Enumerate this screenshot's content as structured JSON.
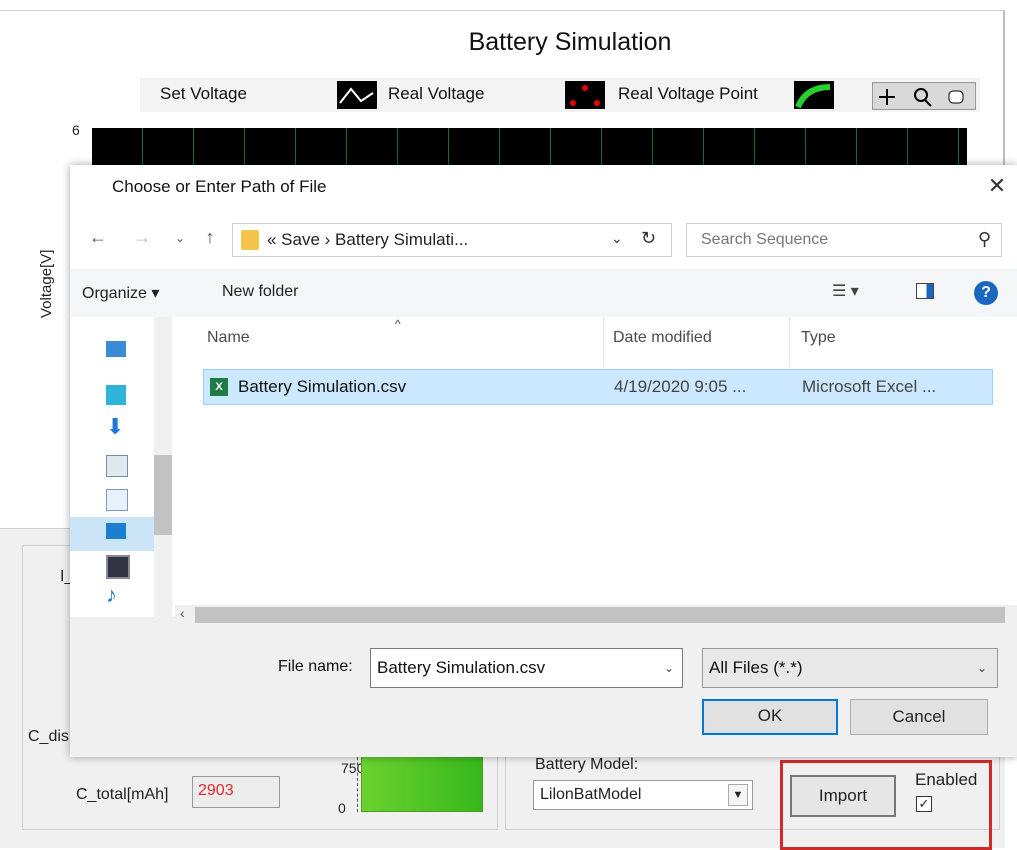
{
  "app": {
    "title": "Battery Simulation",
    "legend": {
      "set_voltage": "Set Voltage",
      "real_voltage": "Real Voltage",
      "real_voltage_point": "Real Voltage Point"
    },
    "y_axis_label": "Voltage[V]",
    "y_tick_top": "6",
    "cut_label_i": "I_",
    "cut_label_c": "C_dis",
    "c_total_label": "C_total[mAh]",
    "c_total_value": "2903",
    "gauge_zero": "0",
    "gauge_tick": "750",
    "battery_model_label": "Battery Model:",
    "battery_model_value": "LilonBatModel",
    "import_label": "Import",
    "enabled_label": "Enabled",
    "enabled_checked": true,
    "colors": {
      "highlight": "#d02a2a",
      "gauge": "#5ccf28",
      "value_red": "#e0292e"
    }
  },
  "dialog": {
    "title": "Choose or Enter Path of File",
    "breadcrumb": "«  Save  ›  Battery Simulati...",
    "search_placeholder": "Search Sequence",
    "toolbar": {
      "organize": "Organize ▾",
      "new_folder": "New folder"
    },
    "columns": {
      "name": "Name",
      "date": "Date modified",
      "type": "Type"
    },
    "files": [
      {
        "name": "Battery Simulation.csv",
        "date": "4/19/2020 9:05 ...",
        "type": "Microsoft Excel ..."
      }
    ],
    "file_name_label": "File name:",
    "file_name_value": "Battery Simulation.csv",
    "filter_value": "All Files (*.*)",
    "ok_label": "OK",
    "cancel_label": "Cancel"
  }
}
